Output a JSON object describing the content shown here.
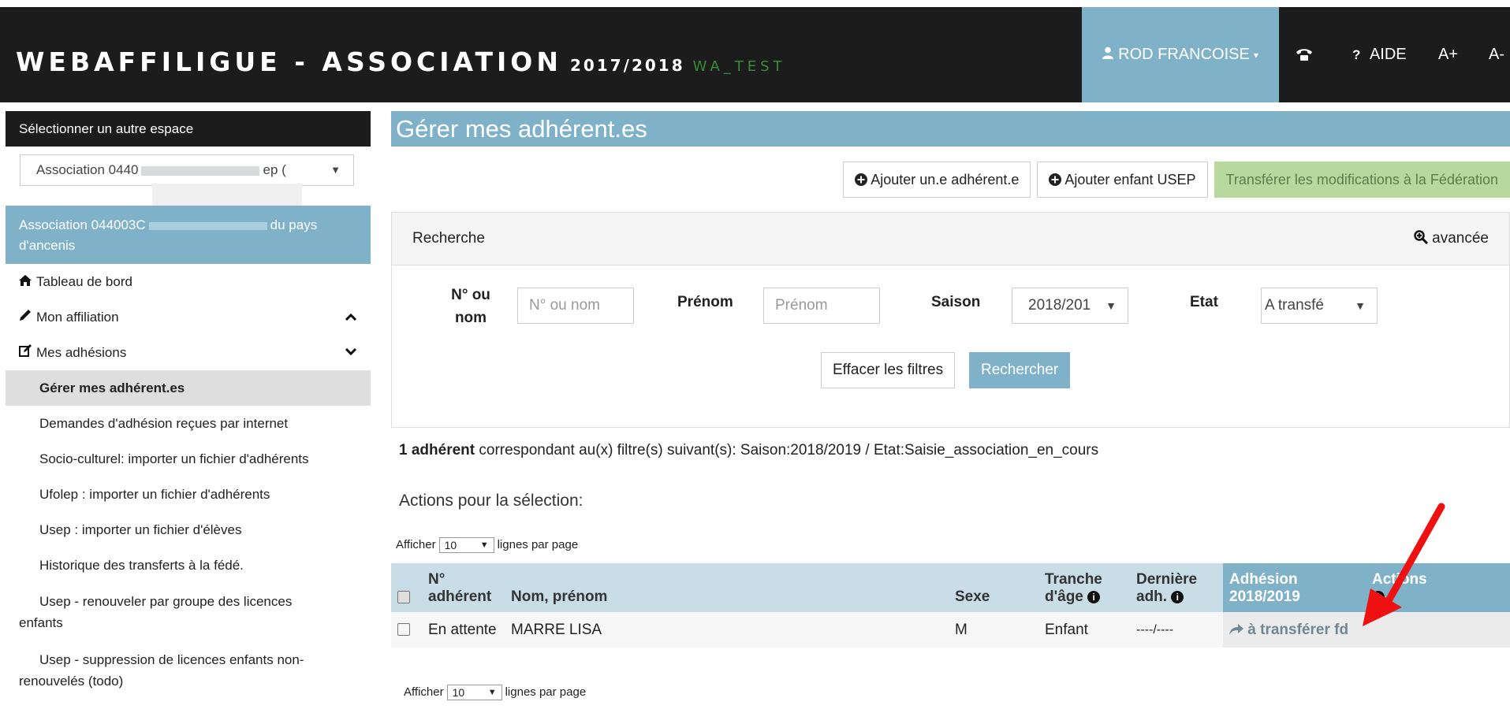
{
  "header": {
    "brand": "WEBAFFILIGUE - ASSOCIATION",
    "season": "2017/2018",
    "env": "WA_TEST",
    "user": "ROD FRANCOISE",
    "help": "AIDE",
    "font_plus": "A+",
    "font_minus": "A-",
    "icons": {
      "user": "user-icon",
      "phone": "phone-icon",
      "help": "question-icon"
    }
  },
  "sidebar": {
    "space_label": "Sélectionner un autre espace",
    "space_select_start": "Association 0440",
    "space_select_end": "ep (",
    "assoc_line_start": "Association 044003C",
    "assoc_line_end": "du pays",
    "assoc_line2": "d'ancenis",
    "menu": {
      "dashboard": "Tableau de bord",
      "affiliation": "Mon affiliation",
      "adhesions": "Mes adhésions",
      "gerer": "Gérer mes adhérent.es",
      "demandes": "Demandes d'adhésion reçues par internet",
      "socio": "Socio-culturel: importer un fichier d'adhérents",
      "ufolep": "Ufolep : importer un fichier d'adhérents",
      "usep_import": "Usep : importer un fichier d'élèves",
      "historique": "Historique des transferts à la fédé.",
      "usep_renew_1": "Usep - renouveler par groupe des licences",
      "usep_renew_2": "enfants",
      "usep_delete_1": "Usep - suppression de licences enfants non-",
      "usep_delete_2": "renouvelés (todo)"
    }
  },
  "main": {
    "title": "Gérer mes adhérent.es",
    "buttons": {
      "add_member": "Ajouter un.e adhérent.e",
      "add_child": "Ajouter enfant USEP",
      "transfer": "Transférer les modifications à la Fédération"
    },
    "search": {
      "title": "Recherche",
      "advanced": "avancée",
      "num_label_1": "N° ou",
      "num_label_2": "nom",
      "num_placeholder": "N° ou nom",
      "firstname_label": "Prénom",
      "firstname_placeholder": "Prénom",
      "season_label": "Saison",
      "season_value": "2018/201",
      "state_label": "Etat",
      "state_value": "A transfé",
      "clear": "Effacer les filtres",
      "submit": "Rechercher"
    },
    "summary_bold": "1 adhérent",
    "summary_rest": " correspondant au(x) filtre(s) suivant(s): Saison:2018/2019 / Etat:Saisie_association_en_cours",
    "actions_label": "Actions pour la sélection:",
    "per_page": {
      "before": "Afficher",
      "value": "10",
      "after": "lignes par page"
    },
    "table": {
      "headers": {
        "num_1": "N°",
        "num_2": "adhérent",
        "name": "Nom, prénom",
        "sex": "Sexe",
        "age_1": "Tranche",
        "age_2": "d'âge",
        "last_1": "Dernière",
        "last_2": "adh.",
        "adh_1": "Adhésion",
        "adh_2": "2018/2019",
        "actions": "Actions"
      },
      "rows": [
        {
          "num": "En attente",
          "name": "MARRE LISA",
          "sex": "M",
          "age": "Enfant",
          "last": "----/----",
          "status": "à transférer fd"
        }
      ]
    }
  },
  "colors": {
    "header_bg": "#1c1c1c",
    "accent": "#7fb1c8",
    "green_btn": "#b7d9a0",
    "arrow": "#ee1111"
  }
}
